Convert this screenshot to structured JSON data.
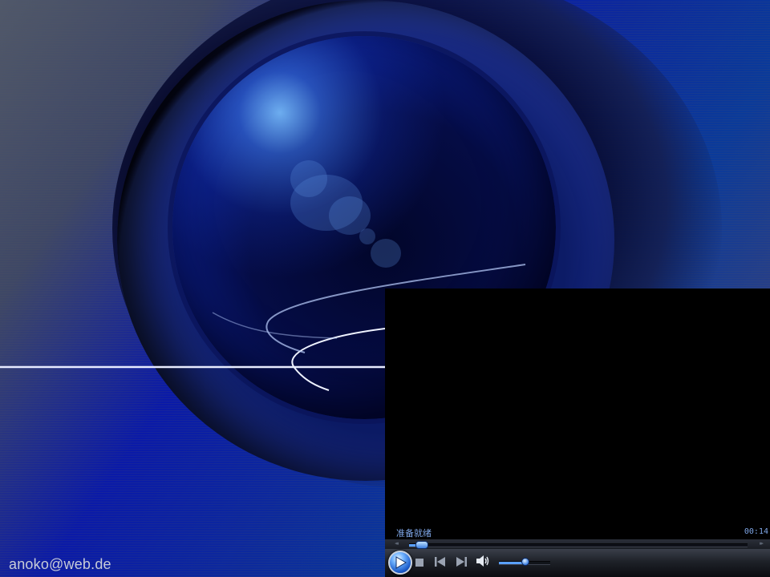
{
  "desktop": {
    "watermark_text": "anoko@web.de"
  },
  "player": {
    "status_text": "准备就绪",
    "time_text": "00:14",
    "seek_progress": 0.02,
    "volume_level": 0.5,
    "seek_back_glyph": "◂◂",
    "seek_forward_glyph": "▸▸",
    "colors": {
      "accent": "#5aa0ff",
      "status_text": "#7fa7e8",
      "video_bg": "#000000"
    },
    "controls": {
      "play_icon": "play-icon",
      "stop_icon": "stop-icon",
      "prev_icon": "previous-icon",
      "next_icon": "next-icon",
      "mute_icon": "speaker-icon"
    }
  }
}
